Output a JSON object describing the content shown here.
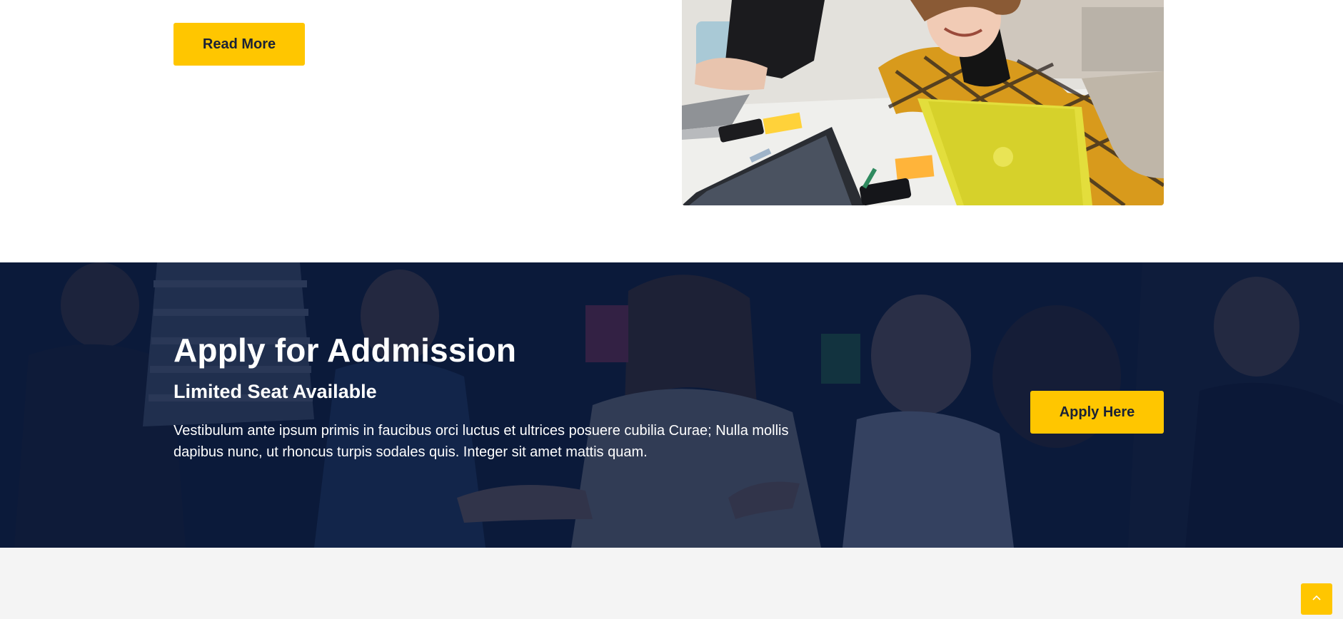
{
  "about": {
    "read_more_label": "Read More"
  },
  "admission": {
    "title": "Apply for Addmission",
    "subtitle": "Limited Seat Available",
    "description": "Vestibulum ante ipsum primis in faucibus orci luctus et ultrices posuere cubilia Curae; Nulla mollis dapibus nunc, ut rhoncus turpis sodales quis. Integer sit amet mattis quam.",
    "apply_label": "Apply Here"
  },
  "scroll_top": {
    "icon": "chevron-up-icon"
  },
  "colors": {
    "accent": "#ffc600",
    "banner_overlay": "#07163a",
    "text_dark": "#1a2236",
    "section_grey": "#f4f4f4"
  }
}
